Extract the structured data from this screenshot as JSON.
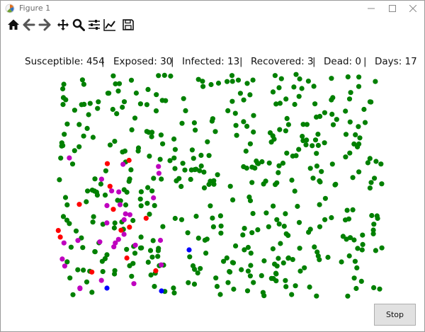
{
  "window": {
    "title": "Figure 1",
    "icon": "matplotlib-icon"
  },
  "toolbar": {
    "items": [
      {
        "name": "home-icon"
      },
      {
        "name": "back-arrow-icon"
      },
      {
        "name": "forward-arrow-icon"
      },
      {
        "name": "pan-move-icon"
      },
      {
        "name": "zoom-magnifier-icon"
      },
      {
        "name": "configure-subplots-icon"
      },
      {
        "name": "edit-axis-curves-icon"
      },
      {
        "name": "save-floppy-icon"
      }
    ]
  },
  "stats": {
    "susceptible": "Susceptible: 454",
    "exposed": "Exposed: 30",
    "infected": "Infected: 13",
    "recovered": "Recovered: 3",
    "dead": "Dead: 0",
    "days": "Days: 17",
    "separator": "|"
  },
  "colors": {
    "susceptible": "#008000",
    "exposed": "#bf00bf",
    "infected": "#ff0000",
    "recovered": "#0000ff"
  },
  "controls": {
    "stop_label": "Stop"
  }
}
